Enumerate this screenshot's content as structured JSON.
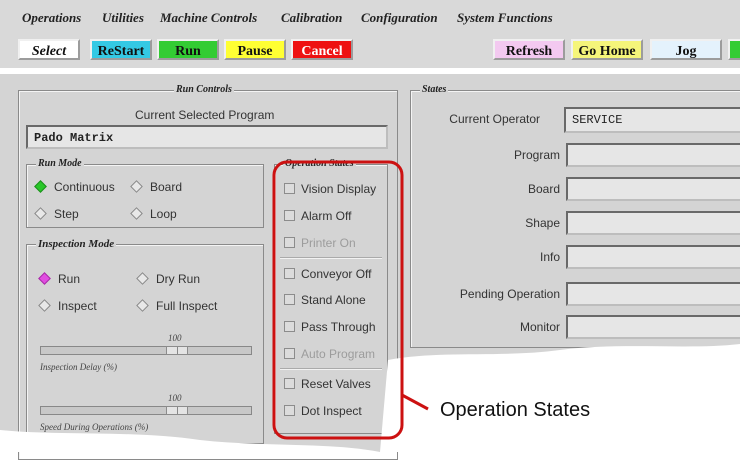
{
  "menu": [
    "Operations",
    "Utilities",
    "Machine Controls",
    "Calibration",
    "Configuration",
    "System Functions"
  ],
  "toolbar": {
    "select": "Select",
    "restart": "ReStart",
    "run": "Run",
    "pause": "Pause",
    "cancel": "Cancel",
    "refresh": "Refresh",
    "go_home": "Go Home",
    "jog": "Jog"
  },
  "colors": {
    "select": "#ffffff",
    "restart": "#34c9e4",
    "run": "#33cc33",
    "pause": "#ffff33",
    "cancel": "#ee1111",
    "refresh": "#f3c9f0",
    "go_home": "#f5f57a",
    "jog": "#e4f2fc",
    "highlight": "#cc1111"
  },
  "run_controls": {
    "title": "Run Controls",
    "current_program_label": "Current Selected Program",
    "current_program": "Pado Matrix",
    "run_mode": {
      "title": "Run Mode",
      "options": [
        "Continuous",
        "Board",
        "Step",
        "Loop"
      ],
      "selected": "Continuous"
    },
    "inspection_mode": {
      "title": "Inspection Mode",
      "options": [
        "Run",
        "Dry Run",
        "Inspect",
        "Full Inspect"
      ],
      "selected": "Run"
    },
    "inspection_delay": {
      "value": "100",
      "label": "Inspection Delay (%)"
    },
    "speed": {
      "value": "100",
      "label": "Speed During Operations (%)"
    }
  },
  "operation_states": {
    "title": "Operation States",
    "items": [
      {
        "label": "Vision Display",
        "enabled": true
      },
      {
        "label": "Alarm Off",
        "enabled": true
      },
      {
        "label": "Printer On",
        "enabled": false
      },
      {
        "label": "Conveyor Off",
        "enabled": true
      },
      {
        "label": "Stand Alone",
        "enabled": true
      },
      {
        "label": "Pass Through",
        "enabled": true
      },
      {
        "label": "Auto Program",
        "enabled": false
      },
      {
        "label": "Reset Valves",
        "enabled": true
      },
      {
        "label": "Dot Inspect",
        "enabled": true
      }
    ]
  },
  "states": {
    "title": "States",
    "fields": [
      {
        "label": "Current Operator",
        "value": "SERVICE"
      },
      {
        "label": "Program",
        "value": ""
      },
      {
        "label": "Board",
        "value": ""
      },
      {
        "label": "Shape",
        "value": ""
      },
      {
        "label": "Info",
        "value": ""
      },
      {
        "label": "Pending Operation",
        "value": ""
      },
      {
        "label": "Monitor",
        "value": ""
      }
    ]
  },
  "callout": "Operation States"
}
